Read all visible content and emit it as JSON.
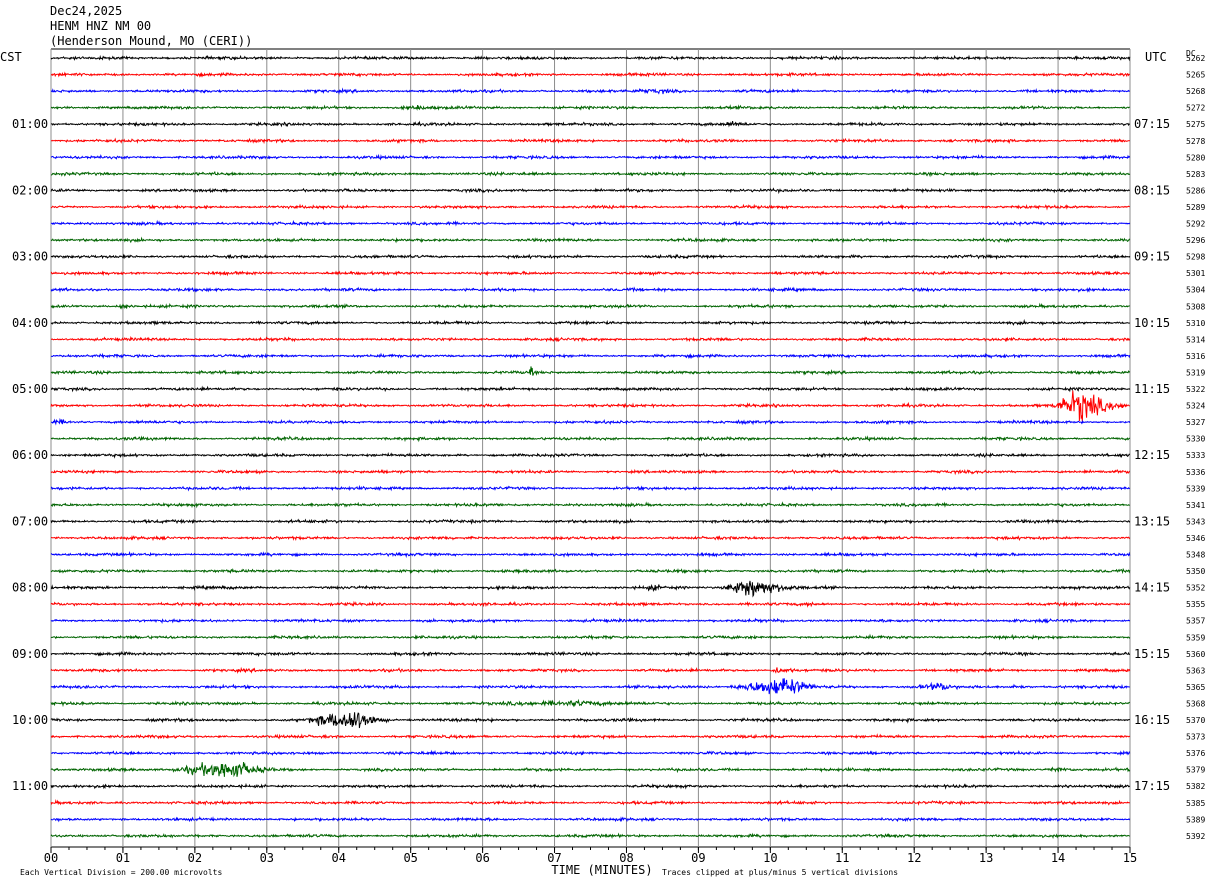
{
  "header": {
    "date": "Dec24,2025",
    "station": "HENM HNZ NM 00",
    "location": "(Henderson Mound, MO (CERI))"
  },
  "chart_data": {
    "type": "line",
    "left_axis_label": "CST",
    "right_axis_label": "UTC",
    "right_column_header": "DC",
    "xlabel": "TIME (MINUTES)",
    "x_ticks": [
      "00",
      "01",
      "02",
      "03",
      "04",
      "05",
      "06",
      "07",
      "08",
      "09",
      "10",
      "11",
      "12",
      "13",
      "14",
      "15"
    ],
    "xlim": [
      0,
      15
    ],
    "cst_labels": [
      "01:00",
      "02:00",
      "03:00",
      "04:00",
      "05:00",
      "06:00",
      "07:00",
      "08:00",
      "09:00",
      "10:00",
      "11:00"
    ],
    "utc_labels": [
      "07:15",
      "08:15",
      "09:15",
      "10:15",
      "11:15",
      "12:15",
      "13:15",
      "14:15",
      "15:15",
      "16:15",
      "17:15"
    ],
    "hour_label_start_trace": 4,
    "traces_per_hour": 4,
    "trace_colors": [
      "#000000",
      "#ff0000",
      "#0000ff",
      "#006400"
    ],
    "dc_offsets": [
      "5262",
      "5265",
      "5268",
      "5272",
      "5275",
      "5278",
      "5280",
      "5283",
      "5286",
      "5289",
      "5292",
      "5296",
      "5298",
      "5301",
      "5304",
      "5308",
      "5310",
      "5314",
      "5316",
      "5319",
      "5322",
      "5324",
      "5327",
      "5330",
      "5333",
      "5336",
      "5339",
      "5341",
      "5343",
      "5346",
      "5348",
      "5350",
      "5352",
      "5355",
      "5357",
      "5359",
      "5360",
      "5363",
      "5365",
      "5368",
      "5370",
      "5373",
      "5376",
      "5379",
      "5382",
      "5385",
      "5389",
      "5392"
    ],
    "events": [
      {
        "trace": 20,
        "start_min": 0.0,
        "end_min": 15.0,
        "peak_min": 0.0,
        "amplitude": 0
      },
      {
        "trace": 21,
        "start_min": 13.9,
        "end_min": 15.0,
        "peak_min": 14.35,
        "amplitude": 3.0
      },
      {
        "trace": 22,
        "start_min": 0.0,
        "end_min": 0.45,
        "peak_min": 0.1,
        "amplitude": 0.35
      },
      {
        "trace": 19,
        "start_min": 6.65,
        "end_min": 6.7,
        "peak_min": 6.67,
        "amplitude": 1.4
      },
      {
        "trace": 32,
        "start_min": 9.3,
        "end_min": 10.4,
        "peak_min": 9.75,
        "amplitude": 1.9
      },
      {
        "trace": 32,
        "start_min": 8.2,
        "end_min": 8.6,
        "peak_min": 8.4,
        "amplitude": 0.35
      },
      {
        "trace": 38,
        "start_min": 9.4,
        "end_min": 10.7,
        "peak_min": 10.25,
        "amplitude": 1.8
      },
      {
        "trace": 38,
        "start_min": 12.0,
        "end_min": 12.6,
        "peak_min": 12.4,
        "amplitude": 0.6
      },
      {
        "trace": 38,
        "start_min": 13.3,
        "end_min": 13.6,
        "peak_min": 13.4,
        "amplitude": 0.4
      },
      {
        "trace": 39,
        "start_min": 6.2,
        "end_min": 8.0,
        "peak_min": 7.4,
        "amplitude": 0.45
      },
      {
        "trace": 40,
        "start_min": 3.5,
        "end_min": 4.7,
        "peak_min": 4.25,
        "amplitude": 2.0
      },
      {
        "trace": 43,
        "start_min": 1.6,
        "end_min": 3.1,
        "peak_min": 2.55,
        "amplitude": 1.7
      },
      {
        "trace": 43,
        "start_min": 13.8,
        "end_min": 14.4,
        "peak_min": 14.0,
        "amplitude": 0.35
      },
      {
        "trace": 37,
        "start_min": 10.0,
        "end_min": 10.4,
        "peak_min": 10.1,
        "amplitude": 0.5
      },
      {
        "trace": 33,
        "start_min": 10.5,
        "end_min": 10.6,
        "peak_min": 10.55,
        "amplitude": 0.5
      },
      {
        "trace": 2,
        "start_min": 8.0,
        "end_min": 9.0,
        "peak_min": 8.5,
        "amplitude": 0.25
      },
      {
        "trace": 4,
        "start_min": 9.3,
        "end_min": 9.7,
        "peak_min": 9.5,
        "amplitude": 0.3
      },
      {
        "trace": 15,
        "start_min": 0.9,
        "end_min": 1.2,
        "peak_min": 1.0,
        "amplitude": 0.4
      },
      {
        "trace": 3,
        "start_min": 4.8,
        "end_min": 5.4,
        "peak_min": 5.1,
        "amplitude": 0.3
      }
    ],
    "footer_left": "Each Vertical Division =  200.00 microvolts",
    "footer_right": "Traces clipped at plus/minus 5 vertical divisions"
  }
}
